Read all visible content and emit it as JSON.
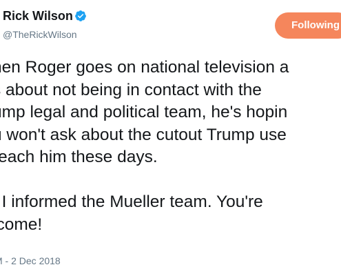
{
  "author": {
    "display_name": "Rick Wilson",
    "handle": "@TheRickWilson",
    "verified_icon": "verified-badge-icon"
  },
  "follow_button": {
    "label": "Following"
  },
  "tweet": {
    "lines": [
      "hen Roger goes on national television a",
      "s about not being in contact with the",
      "ump legal and political team, he's hopin",
      "u won't ask about the cutout Trump use",
      "reach him these days."
    ],
    "lines2": [
      ", I informed the Mueller team. You're",
      "lcome!"
    ]
  },
  "timestamp": "M - 2 Dec 2018",
  "colors": {
    "follow_bg": "#f5865c",
    "verified": "#1da1f2",
    "secondary_text": "#657786"
  }
}
